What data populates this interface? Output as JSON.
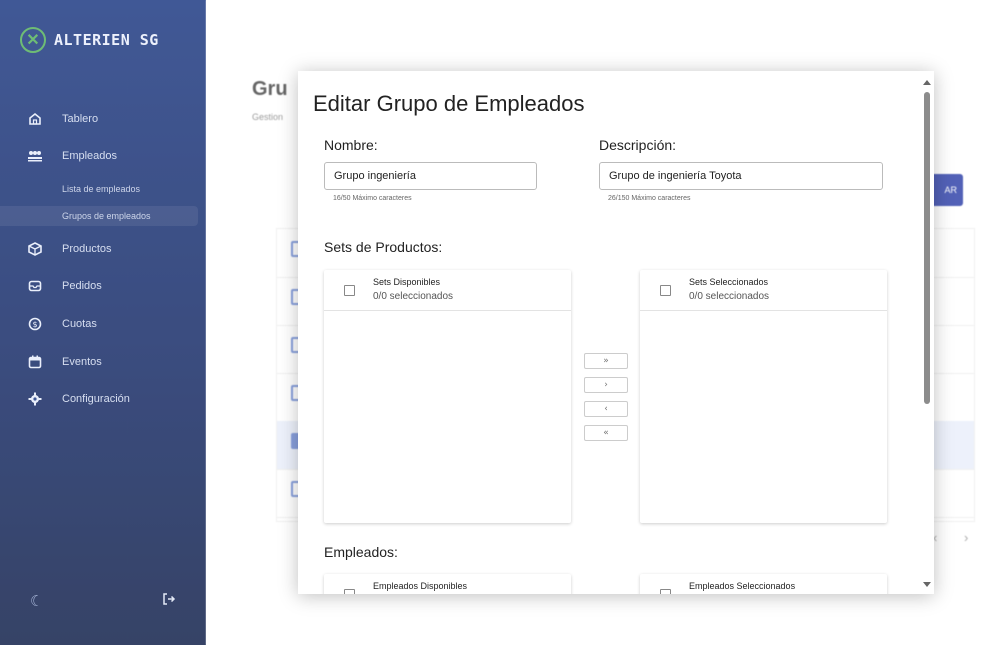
{
  "sidebar": {
    "brand": "ALTERIEN SG",
    "items": [
      {
        "label": "Tablero",
        "icon": "home-icon"
      },
      {
        "label": "Empleados",
        "icon": "people-icon"
      },
      {
        "label": "Productos",
        "icon": "box-icon"
      },
      {
        "label": "Pedidos",
        "icon": "inbox-icon"
      },
      {
        "label": "Cuotas",
        "icon": "coin-icon"
      },
      {
        "label": "Eventos",
        "icon": "calendar-icon"
      },
      {
        "label": "Configuración",
        "icon": "gear-icon"
      }
    ],
    "subitems": [
      {
        "label": "Lista de empleados",
        "active": false
      },
      {
        "label": "Grupos de empleados",
        "active": true
      }
    ],
    "bottom": {
      "theme_icon": "moon-icon",
      "logout_icon": "logout-icon"
    }
  },
  "page": {
    "title": "Gru",
    "subtitle": "Gestion",
    "button_label": "AR"
  },
  "modal": {
    "title": "Editar Grupo de Empleados",
    "name": {
      "label": "Nombre:",
      "value": "Grupo ingeniería",
      "helper": "16/50 Máximo caracteres"
    },
    "description": {
      "label": "Descripción:",
      "value": "Grupo de ingeniería Toyota",
      "helper": "26/150 Máximo caracteres"
    },
    "product_sets": {
      "label": "Sets de Productos:",
      "available": {
        "title": "Sets Disponibles",
        "count": "0/0 seleccionados"
      },
      "selected": {
        "title": "Sets Seleccionados",
        "count": "0/0 seleccionados"
      },
      "buttons": {
        "all_right": "»",
        "right": "›",
        "left": "‹",
        "all_left": "«"
      }
    },
    "employees": {
      "label": "Empleados:",
      "available": {
        "title": "Empleados Disponibles"
      },
      "selected": {
        "title": "Empleados Seleccionados"
      }
    }
  },
  "colors": {
    "sidebar": "#17347f",
    "accent": "#2c3fa8",
    "logo_green": "#4fae57"
  }
}
